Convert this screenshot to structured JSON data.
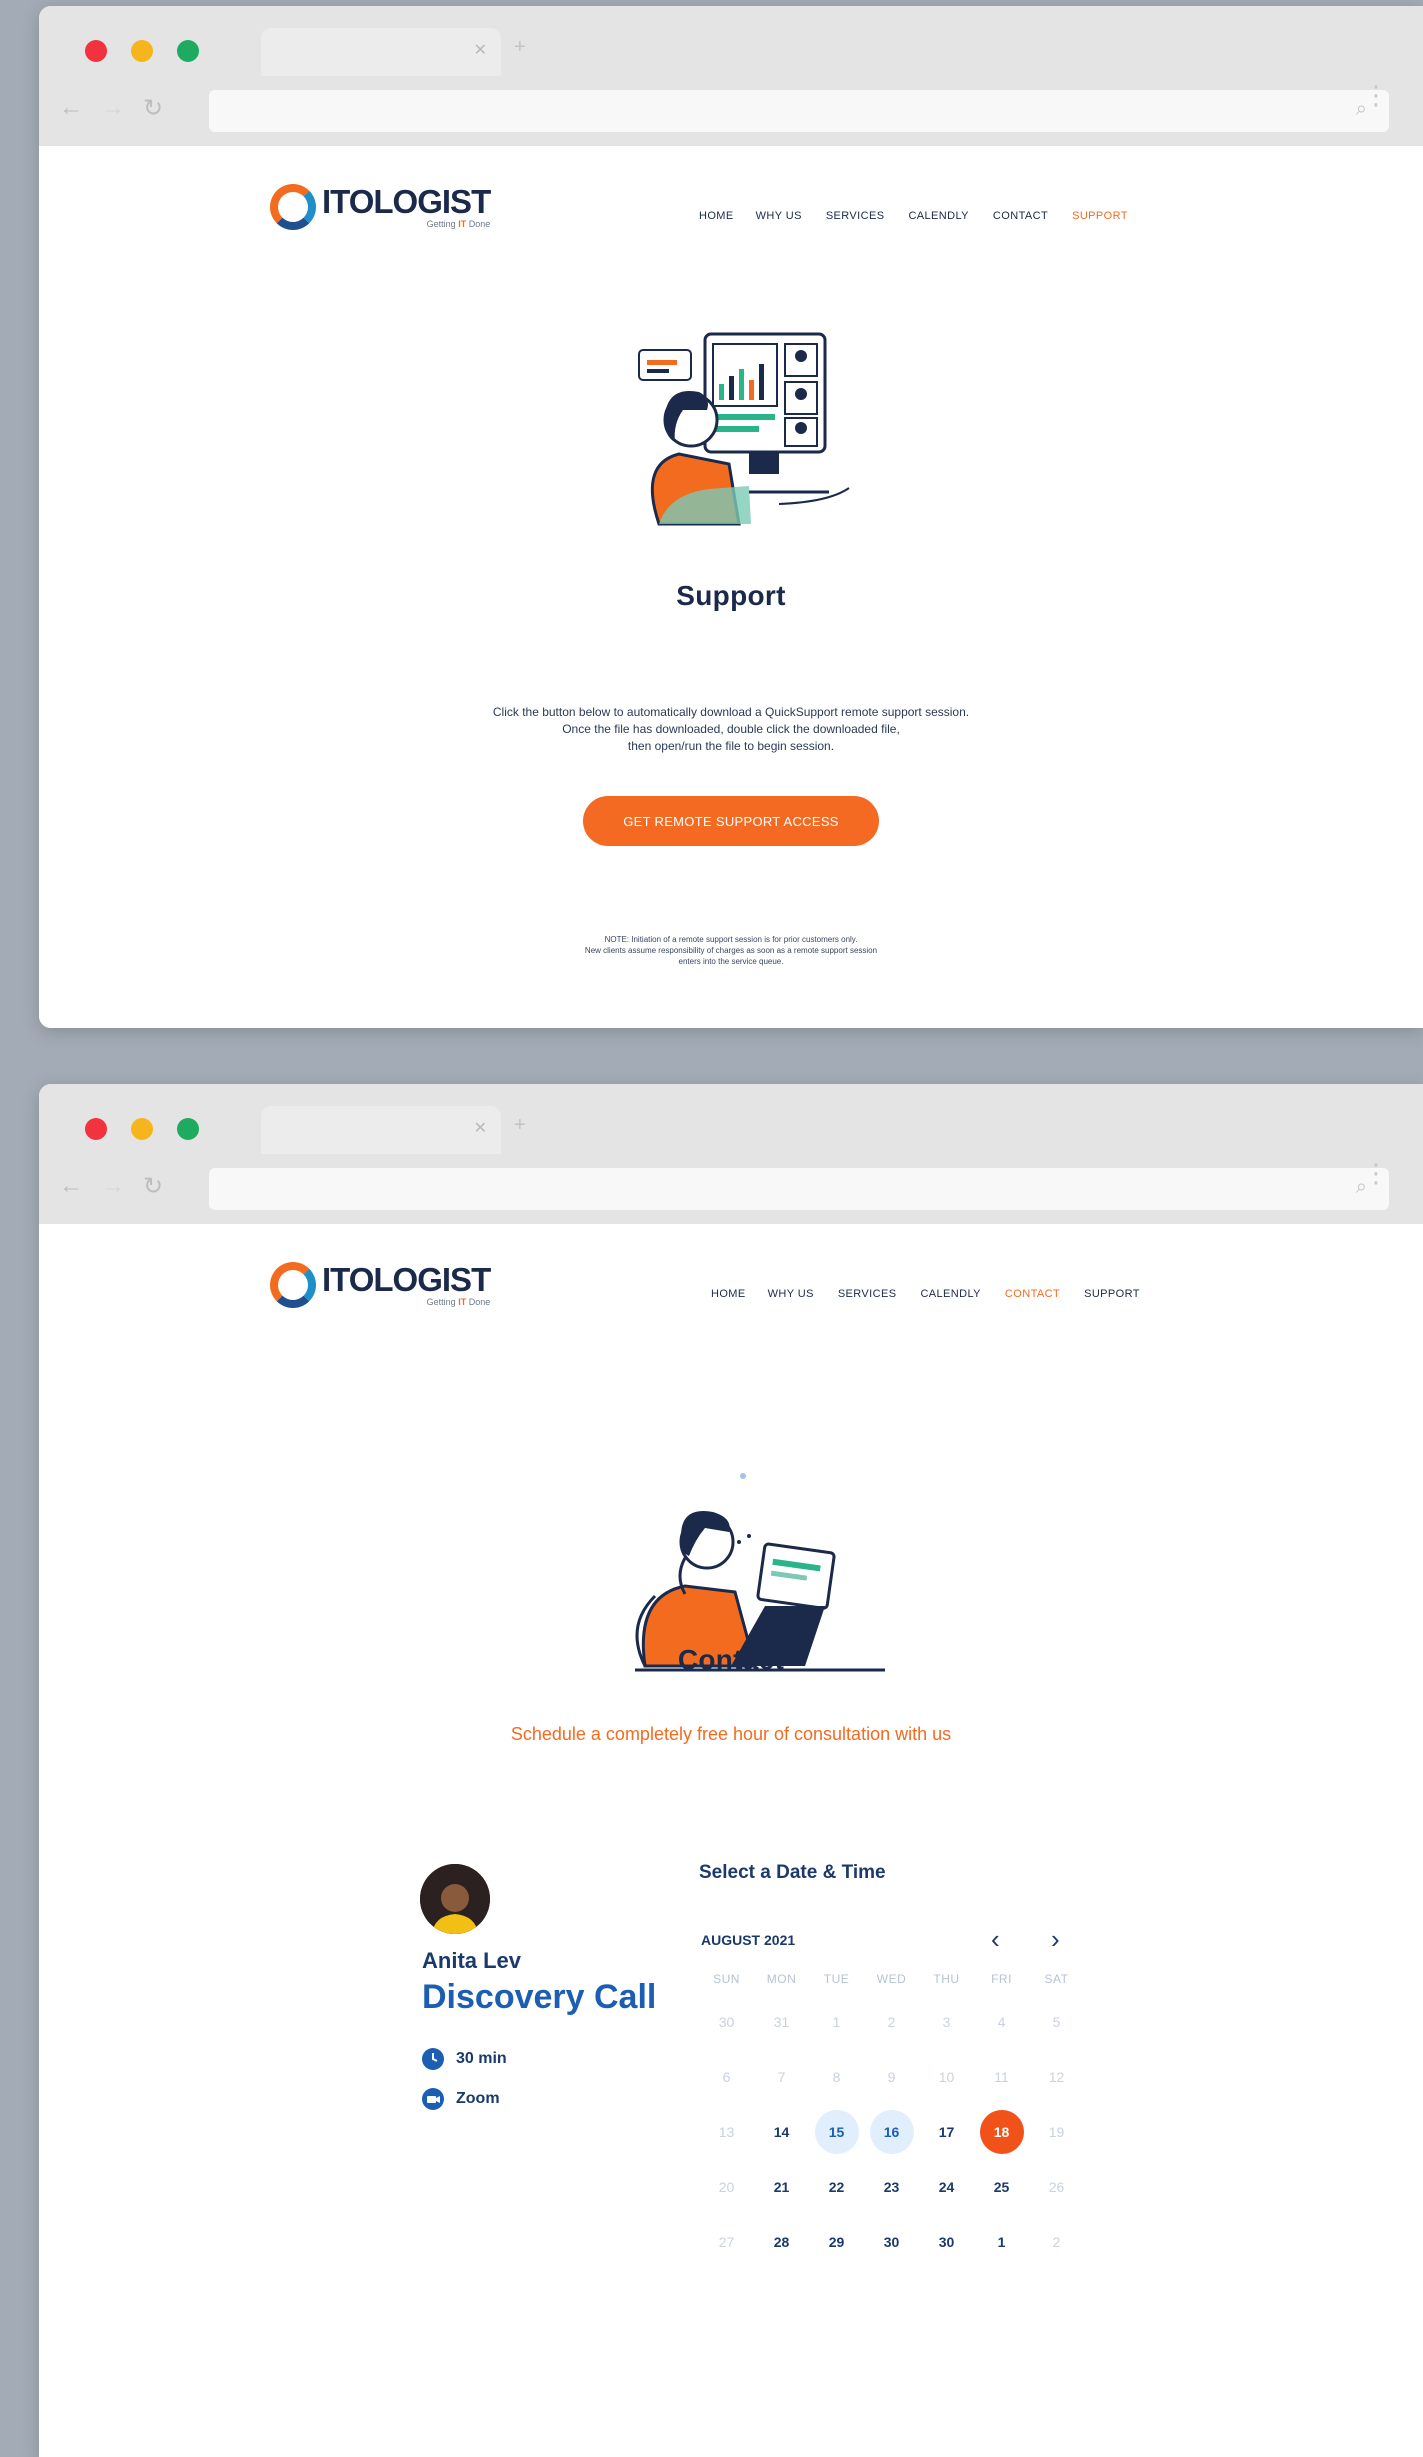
{
  "support_window": {
    "logo": {
      "title": "ITOLOGIST",
      "tag_prefix": "Getting ",
      "tag_highlight": "IT",
      "tag_suffix": " Done"
    },
    "menu": [
      {
        "label": "HOME",
        "active": false
      },
      {
        "label": "WHY US",
        "active": false
      },
      {
        "label": "SERVICES",
        "active": false
      },
      {
        "label": "CALENDLY",
        "active": false
      },
      {
        "label": "CONTACT",
        "active": false
      },
      {
        "label": "SUPPORT",
        "active": true
      }
    ],
    "title": "Support",
    "instructions": [
      "Click the button below to automatically download a QuickSupport remote support session.",
      "Once the file has downloaded, double click the downloaded file,",
      "then open/run the file to begin session."
    ],
    "cta_label": "GET REMOTE SUPPORT ACCESS",
    "note": [
      "NOTE: Initiation of a remote support session is for prior customers only.",
      "New clients assume responsibility of charges as soon as a remote support session",
      "enters into the service queue."
    ]
  },
  "contact_window": {
    "logo": {
      "title": "ITOLOGIST",
      "tag_prefix": "Getting ",
      "tag_highlight": "IT",
      "tag_suffix": " Done"
    },
    "menu": [
      {
        "label": "HOME",
        "active": false
      },
      {
        "label": "WHY US",
        "active": false
      },
      {
        "label": "SERVICES",
        "active": false
      },
      {
        "label": "CALENDLY",
        "active": false
      },
      {
        "label": "CONTACT",
        "active": true
      },
      {
        "label": "SUPPORT",
        "active": false
      }
    ],
    "title": "Contact",
    "subtitle": "Schedule a completely free hour of consultation with us",
    "booking": {
      "host": "Anita Lev",
      "event": "Discovery Call",
      "duration": "30 min",
      "location": "Zoom",
      "heading": "Select a Date & Time",
      "month": "AUGUST 2021",
      "weekdays": [
        "SUN",
        "MON",
        "TUE",
        "WED",
        "THU",
        "FRI",
        "SAT"
      ],
      "weeks": [
        [
          "30",
          "31",
          "1",
          "2",
          "3",
          "4",
          "5"
        ],
        [
          "6",
          "7",
          "8",
          "9",
          "10",
          "11",
          "12"
        ],
        [
          "13",
          "14",
          "15",
          "16",
          "17",
          "18",
          "19"
        ],
        [
          "20",
          "21",
          "22",
          "23",
          "24",
          "25",
          "26"
        ],
        [
          "27",
          "28",
          "29",
          "30",
          "30",
          "1",
          "2"
        ]
      ],
      "day_states": [
        [
          "dim",
          "dim",
          "dim",
          "dim",
          "dim",
          "dim",
          "dim"
        ],
        [
          "dim",
          "dim",
          "dim",
          "dim",
          "dim",
          "dim",
          "dim"
        ],
        [
          "dim",
          "normal",
          "avail",
          "avail",
          "normal",
          "selected",
          "dim"
        ],
        [
          "dim",
          "normal",
          "normal",
          "normal",
          "normal",
          "normal",
          "dim"
        ],
        [
          "dim",
          "normal",
          "normal",
          "normal",
          "normal",
          "normal",
          "dim"
        ]
      ]
    }
  },
  "colors": {
    "accent": "#f36b1f",
    "navy": "#1b2a4a",
    "blue": "#1b5eb3"
  }
}
